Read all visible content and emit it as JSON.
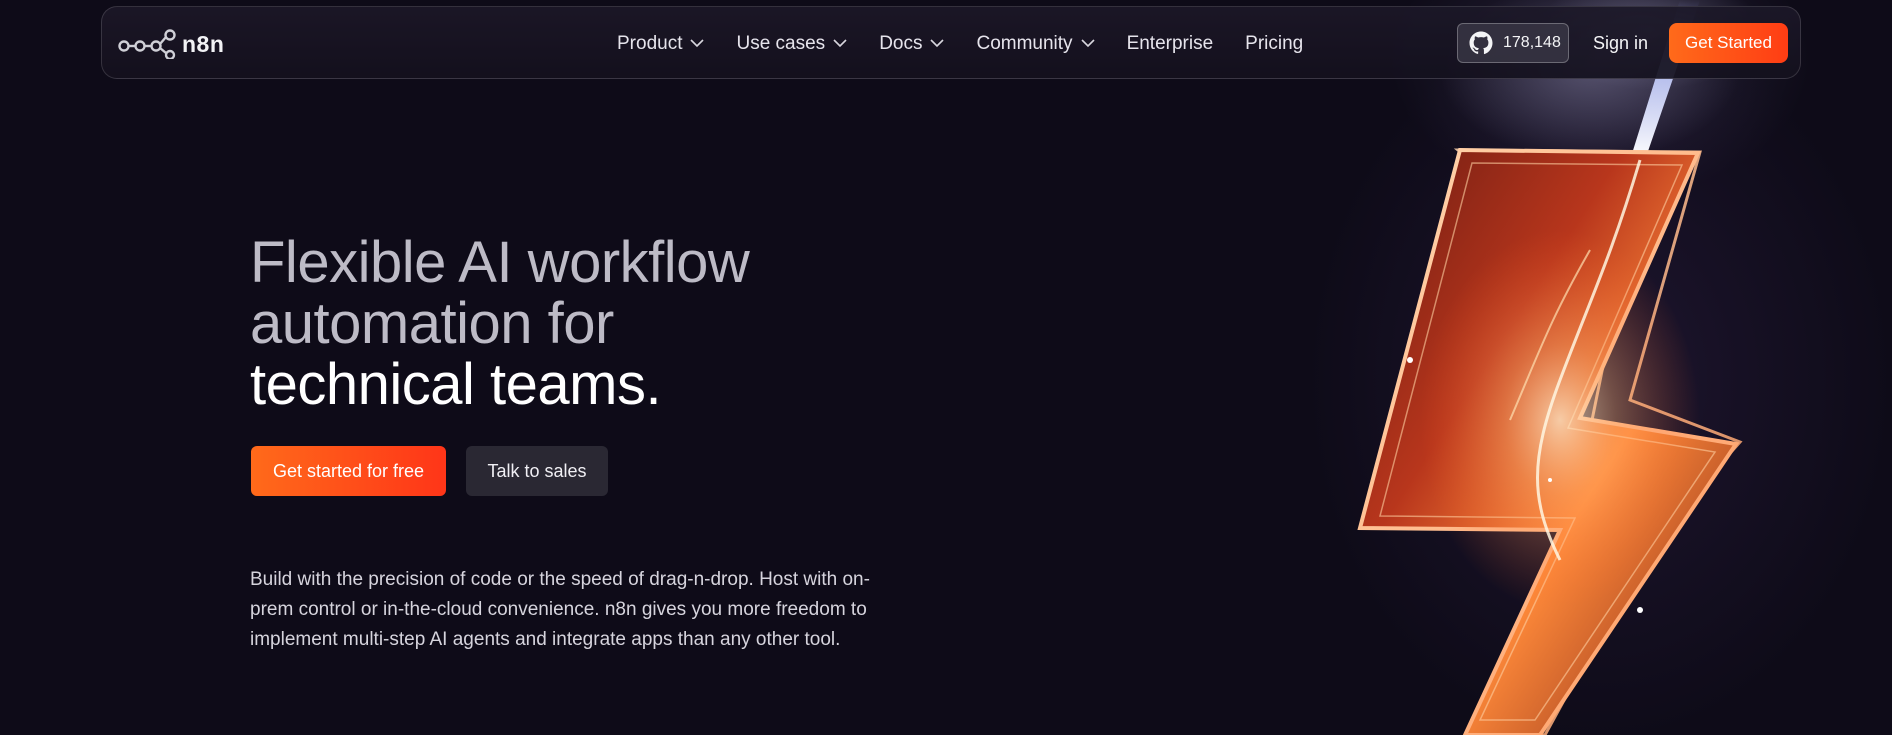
{
  "nav": {
    "logo_text": "n8n",
    "menu": [
      {
        "label": "Product",
        "has_dropdown": true
      },
      {
        "label": "Use cases",
        "has_dropdown": true
      },
      {
        "label": "Docs",
        "has_dropdown": true
      },
      {
        "label": "Community",
        "has_dropdown": true
      },
      {
        "label": "Enterprise",
        "has_dropdown": false
      },
      {
        "label": "Pricing",
        "has_dropdown": false
      }
    ],
    "github_stars": "178,148",
    "sign_in": "Sign in",
    "get_started": "Get Started"
  },
  "hero": {
    "headline_line1": "Flexible AI workflow",
    "headline_line2": "automation for",
    "headline_line3": "technical teams.",
    "cta_primary": "Get started for free",
    "cta_secondary": "Talk to sales",
    "description": "Build with the precision of code or the speed of drag-n-drop. Host with on-prem control or in-the-cloud convenience. n8n gives you more freedom to implement multi-step AI agents and integrate apps than any other tool."
  },
  "colors": {
    "background": "#0e0b18",
    "accent_orange": "#ff5a1f",
    "secondary_button": "#2a2833"
  },
  "icons": [
    "n8n-logo-icon",
    "chevron-down-icon",
    "github-icon",
    "lightning-bolt-illustration"
  ]
}
